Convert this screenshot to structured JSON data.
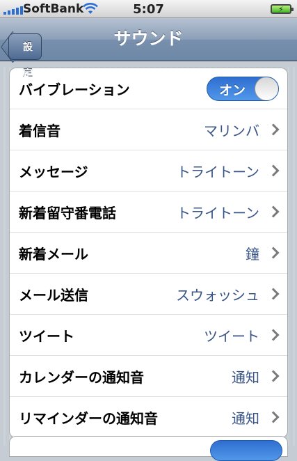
{
  "status": {
    "carrier": "SoftBank",
    "time": "5:07",
    "battery_icon": "battery-charging-icon",
    "wifi_icon": "wifi-icon",
    "signal_icon": "signal-icon"
  },
  "nav": {
    "back_label": "設定",
    "title": "サウンド"
  },
  "vibration": {
    "label": "バイブレーション",
    "toggle_text": "オン",
    "on": true
  },
  "rows": [
    {
      "label": "着信音",
      "value": "マリンバ"
    },
    {
      "label": "メッセージ",
      "value": "トライトーン"
    },
    {
      "label": "新着留守番電話",
      "value": "トライトーン"
    },
    {
      "label": "新着メール",
      "value": "鐘"
    },
    {
      "label": "メール送信",
      "value": "スウォッシュ"
    },
    {
      "label": "ツイート",
      "value": "ツイート"
    },
    {
      "label": "カレンダーの通知音",
      "value": "通知"
    },
    {
      "label": "リマインダーの通知音",
      "value": "通知"
    }
  ],
  "colors": {
    "accent": "#385487",
    "toggle_on": "#3f83df",
    "navbar": "#7890ad"
  }
}
